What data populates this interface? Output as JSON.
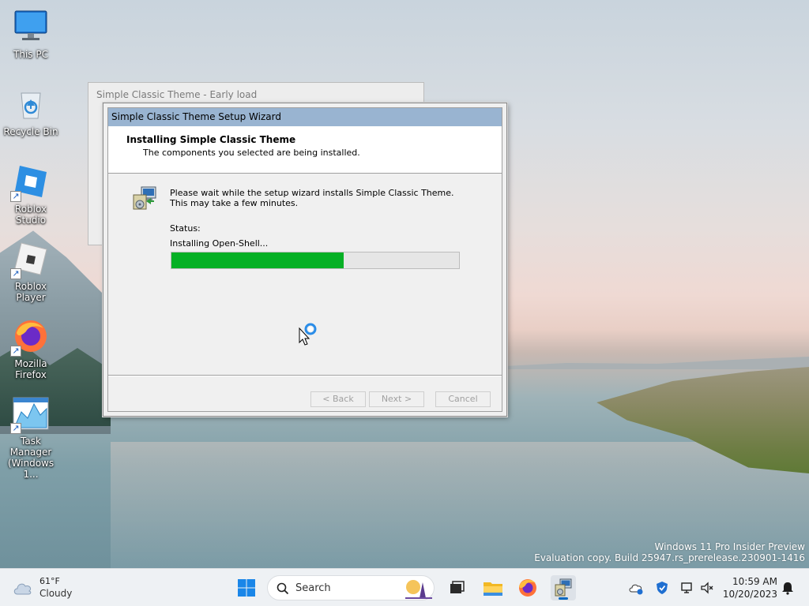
{
  "desktop": {
    "icons": [
      {
        "label": "This PC",
        "icon": "monitor-icon"
      },
      {
        "label": "Recycle Bin",
        "icon": "recycle-bin-icon"
      },
      {
        "label": "Roblox Studio",
        "icon": "roblox-studio-icon"
      },
      {
        "label": "Roblox Player",
        "icon": "roblox-player-icon"
      },
      {
        "label": "Mozilla Firefox",
        "icon": "firefox-icon"
      },
      {
        "label": "Task Manager (Windows 1...",
        "icon": "task-manager-icon"
      }
    ],
    "watermark": {
      "line1": "Windows 11 Pro Insider Preview",
      "line2": "Evaluation copy. Build 25947.rs_prerelease.230901-1416"
    }
  },
  "background_window": {
    "title": "Simple Classic Theme - Early load"
  },
  "wizard": {
    "title": "Simple Classic Theme Setup Wizard",
    "header_title": "Installing Simple Classic Theme",
    "header_subtitle": "The components you selected are being installed.",
    "body_text": "Please wait while the setup wizard installs Simple Classic Theme. This may take a few minutes.",
    "status_label": "Status:",
    "status_value": "Installing Open-Shell...",
    "progress_fraction": 0.6,
    "buttons": {
      "back": "< Back",
      "next": "Next >",
      "cancel": "Cancel"
    }
  },
  "taskbar": {
    "weather": {
      "temp": "61°F",
      "condition": "Cloudy",
      "icon": "cloud-icon"
    },
    "search_placeholder": "Search",
    "apps": [
      "start-icon",
      "search-icon",
      "task-view-icon",
      "file-explorer-icon",
      "firefox-icon",
      "setup-wizard-icon"
    ],
    "tray": [
      "onedrive-icon",
      "defender-icon",
      "network-icon",
      "volume-icon"
    ],
    "clock": {
      "time": "10:59 AM",
      "date": "10/20/2023"
    }
  },
  "colors": {
    "titlebar": "#99b4d1",
    "progress": "#06b025",
    "window_face": "#f0f0f0"
  }
}
